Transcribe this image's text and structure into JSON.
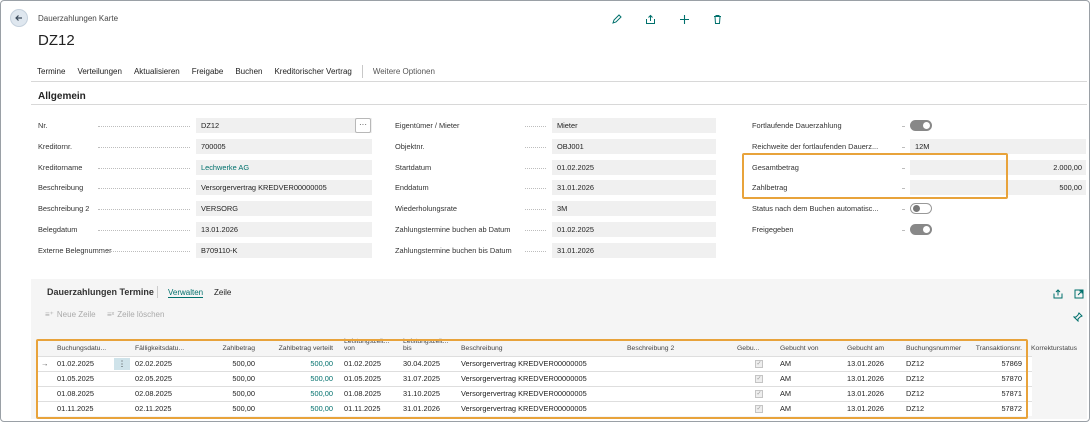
{
  "header": {
    "subtitle": "Dauerzahlungen Karte",
    "title": "DZ12"
  },
  "toolbar": {
    "items": [
      "Termine",
      "Verteilungen",
      "Aktualisieren",
      "Freigabe",
      "Buchen",
      "Kreditorischer Vertrag"
    ],
    "more": "Weitere Optionen"
  },
  "section": {
    "title": "Allgemein"
  },
  "fields_left": [
    {
      "label": "Nr.",
      "value": "DZ12"
    },
    {
      "label": "Kreditornr.",
      "value": "700005"
    },
    {
      "label": "Kreditorname",
      "value": "Lechwerke AG"
    },
    {
      "label": "Beschreibung",
      "value": "Versorgervertrag KREDVER00000005"
    },
    {
      "label": "Beschreibung 2",
      "value": "VERSORG"
    },
    {
      "label": "Belegdatum",
      "value": "13.01.2026"
    },
    {
      "label": "Externe Belegnummer",
      "value": "B709110-K"
    }
  ],
  "fields_mid": [
    {
      "label": "Eigentümer / Mieter",
      "value": "Mieter"
    },
    {
      "label": "Objektnr.",
      "value": "OBJ001"
    },
    {
      "label": "Startdatum",
      "value": "01.02.2025"
    },
    {
      "label": "Enddatum",
      "value": "31.01.2026"
    },
    {
      "label": "Wiederholungsrate",
      "value": "3M"
    },
    {
      "label": "Zahlungstermine buchen ab Datum",
      "value": "01.02.2025"
    },
    {
      "label": "Zahlungstermine buchen bis Datum",
      "value": "31.01.2026"
    }
  ],
  "fields_right": [
    {
      "label": "Fortlaufende Dauerzahlung",
      "value": "",
      "toggle": "on"
    },
    {
      "label": "Reichweite der fortlaufenden Dauerz...",
      "value": "12M"
    },
    {
      "label": "Gesamtbetrag",
      "value": "2.000,00"
    },
    {
      "label": "Zahlbetrag",
      "value": "500,00"
    },
    {
      "label": "Status nach dem Buchen automatisc...",
      "value": "",
      "toggle": "off"
    },
    {
      "label": "Freigegeben",
      "value": "",
      "toggle": "on"
    }
  ],
  "subpage": {
    "title": "Dauerzahlungen Termine",
    "tabs": [
      "Verwalten",
      "Zeile"
    ],
    "actions": [
      "Neue Zeile",
      "Zeile löschen"
    ]
  },
  "table": {
    "headers": [
      "Buchungsdatu...",
      "Fälligkeitsdatu...",
      "Zahlbetrag",
      "Zahlbetrag verteilt",
      "Leistungszeit... von",
      "Leistungszeit... bis",
      "Beschreibung",
      "Beschreibung 2",
      "Gebu...",
      "Gebucht von",
      "Gebucht am",
      "Buchungsnummer",
      "Transaktionsnr.",
      "Korrekturstatus"
    ],
    "rows": [
      [
        "01.02.2025",
        "02.02.2025",
        "500,00",
        "500,00",
        "01.02.2025",
        "30.04.2025",
        "Versorgervertrag KREDVER00000005",
        "",
        "",
        "AM",
        "13.01.2026",
        "DZ12",
        "57869",
        ""
      ],
      [
        "01.05.2025",
        "02.05.2025",
        "500,00",
        "500,00",
        "01.05.2025",
        "31.07.2025",
        "Versorgervertrag KREDVER00000005",
        "",
        "",
        "AM",
        "13.01.2026",
        "DZ12",
        "57870",
        ""
      ],
      [
        "01.08.2025",
        "02.08.2025",
        "500,00",
        "500,00",
        "01.08.2025",
        "31.10.2025",
        "Versorgervertrag KREDVER00000005",
        "",
        "",
        "AM",
        "13.01.2026",
        "DZ12",
        "57871",
        ""
      ],
      [
        "01.11.2025",
        "02.11.2025",
        "500,00",
        "500,00",
        "01.11.2025",
        "31.01.2026",
        "Versorgervertrag KREDVER00000005",
        "",
        "",
        "AM",
        "13.01.2026",
        "DZ12",
        "57872",
        ""
      ]
    ]
  },
  "colors": {
    "accent": "#00706c",
    "highlight": "#e8a33b"
  },
  "icons": [
    "back-arrow-icon",
    "edit-pencil-icon",
    "share-icon",
    "add-plus-icon",
    "delete-trash-icon"
  ]
}
